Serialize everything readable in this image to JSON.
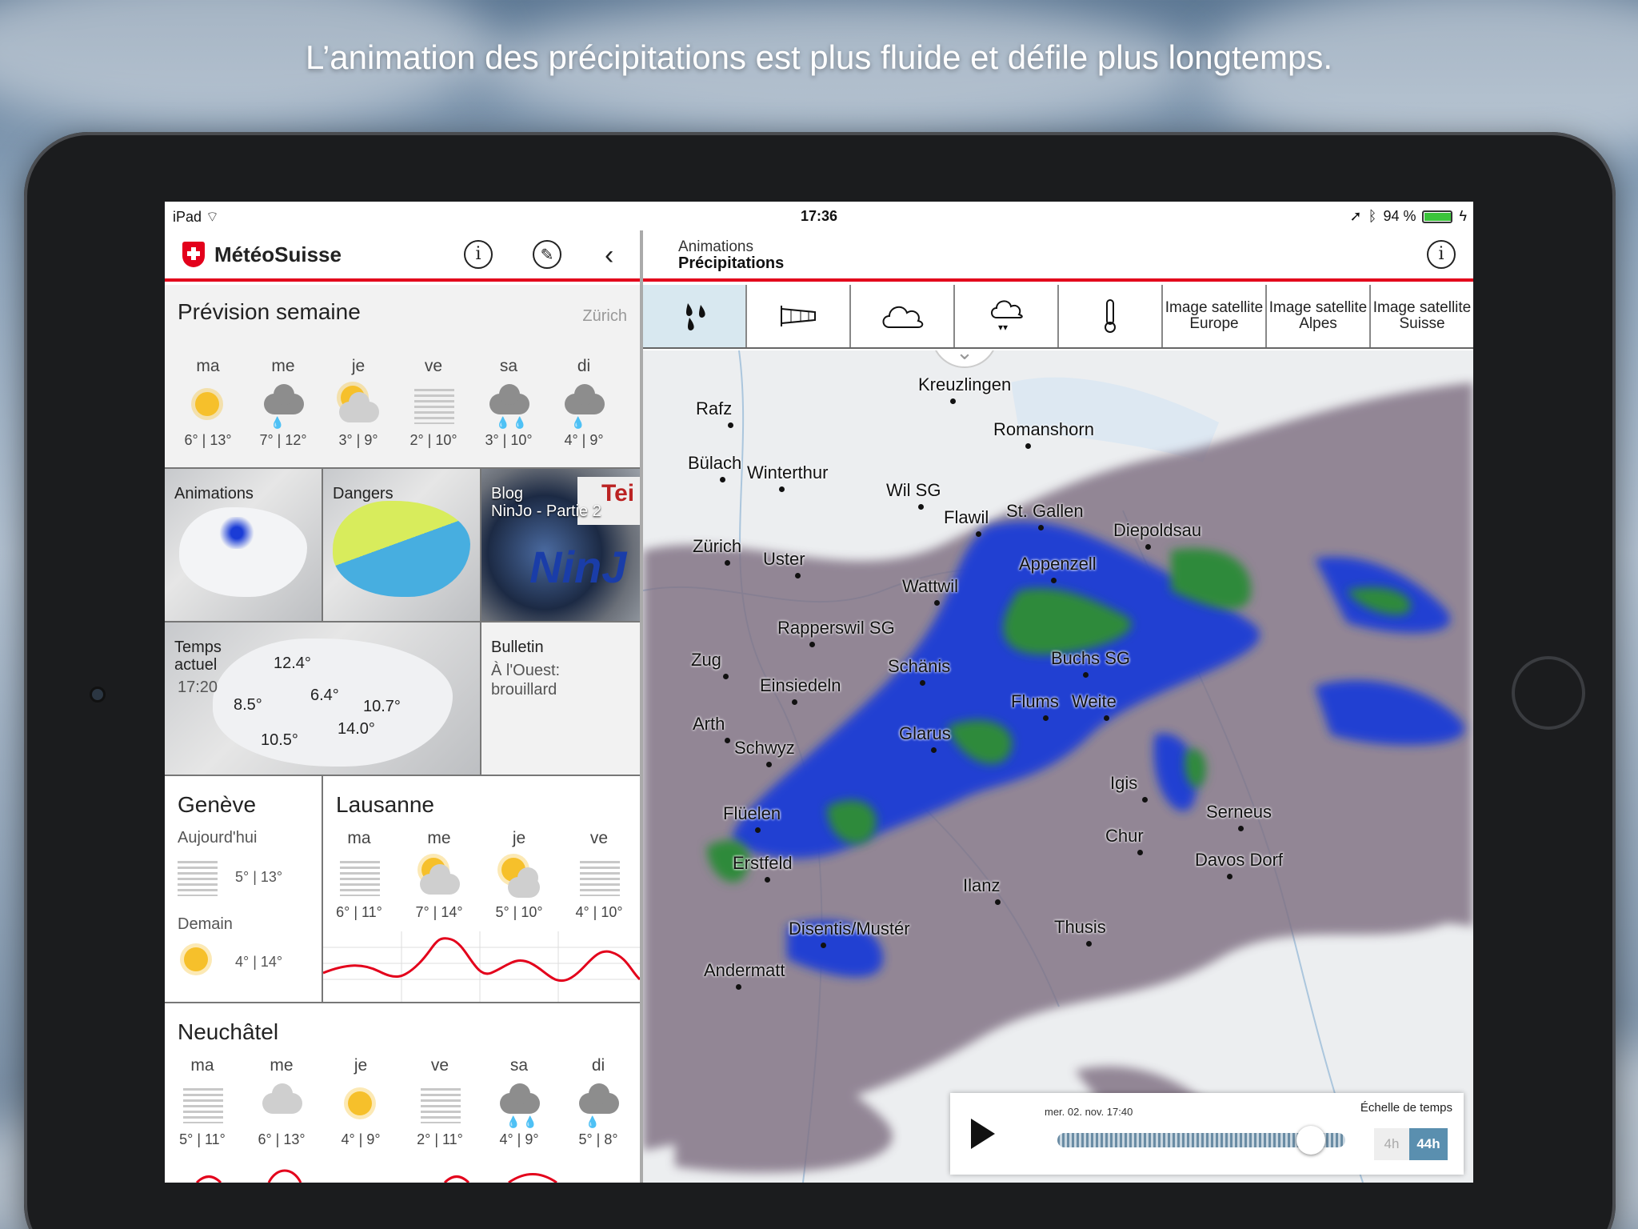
{
  "headline": "L’animation des précipitations est plus fluide et défile plus longtemps.",
  "status": {
    "device": "iPad",
    "time": "17:36",
    "battery": "94 %"
  },
  "app": {
    "name": "MétéoSuisse"
  },
  "week": {
    "title": "Prévision semaine",
    "city": "Zürich",
    "days": [
      {
        "day": "ma",
        "icon": "sunny",
        "temp": "6° | 13°"
      },
      {
        "day": "me",
        "icon": "cloud-rain",
        "temp": "7° | 12°"
      },
      {
        "day": "je",
        "icon": "sun-cloud",
        "temp": "3° | 9°"
      },
      {
        "day": "ve",
        "icon": "fog",
        "temp": "2° | 10°"
      },
      {
        "day": "sa",
        "icon": "cloud-rain-heavy",
        "temp": "3° | 10°"
      },
      {
        "day": "di",
        "icon": "cloud-rain",
        "temp": "4° | 9°"
      }
    ]
  },
  "tiles": {
    "animations": "Animations",
    "dangers": "Dangers",
    "blog": {
      "label": "Blog",
      "sub": "NinJo - Partie 2"
    },
    "current": {
      "label1": "Temps",
      "label2": "actuel",
      "time": "17:20",
      "temps": [
        "12.4°",
        "8.5°",
        "6.4°",
        "10.7°",
        "10.5°",
        "14.0°"
      ]
    },
    "bulletin": {
      "label": "Bulletin",
      "line1": "À l'Ouest:",
      "line2": "brouillard"
    }
  },
  "geneve": {
    "name": "Genève",
    "today": "Aujourd'hui",
    "today_temp": "5° | 13°",
    "tomorrow": "Demain",
    "tomorrow_temp": "4° | 14°"
  },
  "lausanne": {
    "name": "Lausanne",
    "days": [
      {
        "day": "ma",
        "temp": "6° | 11°"
      },
      {
        "day": "me",
        "temp": "7° | 14°"
      },
      {
        "day": "je",
        "temp": "5° | 10°"
      },
      {
        "day": "ve",
        "temp": "4° | 10°"
      }
    ]
  },
  "neuchatel": {
    "name": "Neuchâtel",
    "days": [
      {
        "day": "ma",
        "temp": "5° | 11°"
      },
      {
        "day": "me",
        "temp": "6° | 13°"
      },
      {
        "day": "je",
        "temp": "4° | 9°"
      },
      {
        "day": "ve",
        "temp": "2° | 11°"
      },
      {
        "day": "sa",
        "temp": "4° | 9°"
      },
      {
        "day": "di",
        "temp": "5° | 8°"
      }
    ]
  },
  "right": {
    "title_small": "Animations",
    "title": "Précipitations",
    "tabs": [
      {
        "label": "",
        "icon": "rain-drops-icon"
      },
      {
        "label": "",
        "icon": "windsock-icon"
      },
      {
        "label": "",
        "icon": "cloud-icon"
      },
      {
        "label": "",
        "icon": "hail-icon"
      },
      {
        "label": "",
        "icon": "thermometer-icon"
      },
      {
        "label": "Image satellite Europe"
      },
      {
        "label": "Image satellite Alpes"
      },
      {
        "label": "Image satellite Suisse"
      }
    ],
    "map_labels": [
      "Kreuzlingen",
      "Rafz",
      "Romanshorn",
      "Bülach",
      "Winterthur",
      "Wil SG",
      "Flawil",
      "St. Gallen",
      "Diepoldsau",
      "Zürich",
      "Uster",
      "Appenzell",
      "Wattwil",
      "Rapperswil SG",
      "Zug",
      "Buchs SG",
      "Einsiedeln",
      "Schänis",
      "Arth",
      "Flums",
      "Weite",
      "Glarus",
      "Schwyz",
      "Igis",
      "Serneus",
      "Flüelen",
      "Chur",
      "Erstfeld",
      "Davos Dorf",
      "Ilanz",
      "Disentis/Mustér",
      "Thusis",
      "Andermatt"
    ],
    "player": {
      "date": "mer. 02. nov. 17:40",
      "scale_label": "Échelle de temps",
      "opt1": "4h",
      "opt2": "44h",
      "progress": 0.88
    }
  },
  "colors": {
    "accent": "#e3001b",
    "rain_light": "#7f6f82",
    "rain_mid": "#1a3cd6",
    "rain_heavy": "#2f8a3a"
  }
}
